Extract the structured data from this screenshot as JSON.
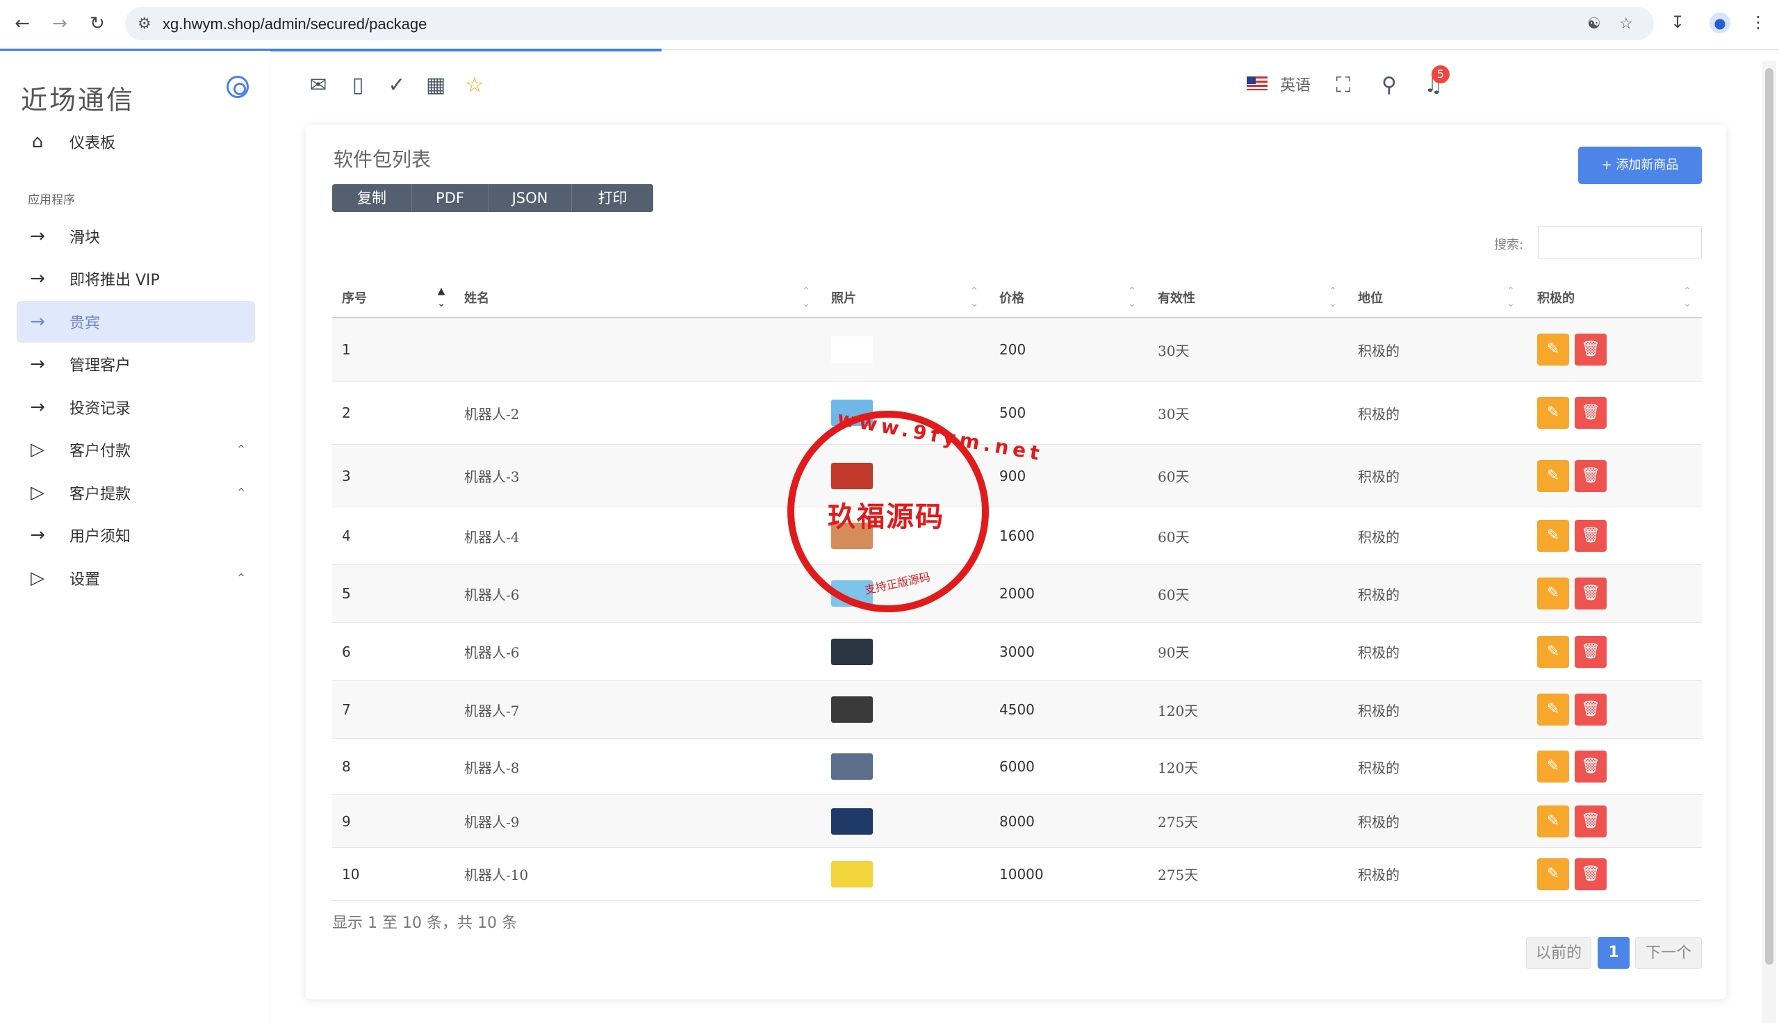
{
  "browser": {
    "url": "xg.hwym.shop/admin/secured/package"
  },
  "sidebar": {
    "brand": "近场通信",
    "section": "应用程序",
    "dashboard": "仪表板",
    "items": [
      {
        "label": "滑块"
      },
      {
        "label": "即将推出 VIP"
      },
      {
        "label": "贵宾"
      },
      {
        "label": "管理客户"
      },
      {
        "label": "投资记录"
      },
      {
        "label": "客户付款"
      },
      {
        "label": "客户提款"
      },
      {
        "label": "用户须知"
      },
      {
        "label": "设置"
      }
    ]
  },
  "topbar": {
    "language": "英语",
    "notification_count": "5"
  },
  "card": {
    "title": "软件包列表",
    "add_button": "+ 添加新商品",
    "export": [
      "复制",
      "PDF",
      "JSON",
      "打印"
    ],
    "search_label": "搜索:",
    "columns": [
      "序号",
      "姓名",
      "照片",
      "价格",
      "有效性",
      "地位",
      "积极的"
    ],
    "rows": [
      {
        "no": "1",
        "name": "",
        "price": "200",
        "validity": "30天",
        "status": "积极的",
        "photo_color": "#ffffff"
      },
      {
        "no": "2",
        "name": "机器人-2",
        "price": "500",
        "validity": "30天",
        "status": "积极的",
        "photo_color": "#6fb7e8"
      },
      {
        "no": "3",
        "name": "机器人-3",
        "price": "900",
        "validity": "60天",
        "status": "积极的",
        "photo_color": "#c0392b"
      },
      {
        "no": "4",
        "name": "机器人-4",
        "price": "1600",
        "validity": "60天",
        "status": "积极的",
        "photo_color": "#d68b5a"
      },
      {
        "no": "5",
        "name": "机器人-6",
        "price": "2000",
        "validity": "60天",
        "status": "积极的",
        "photo_color": "#7ec3ea"
      },
      {
        "no": "6",
        "name": "机器人-6",
        "price": "3000",
        "validity": "90天",
        "status": "积极的",
        "photo_color": "#2b3642"
      },
      {
        "no": "7",
        "name": "机器人-7",
        "price": "4500",
        "validity": "120天",
        "status": "积极的",
        "photo_color": "#3a3a3a"
      },
      {
        "no": "8",
        "name": "机器人-8",
        "price": "6000",
        "validity": "120天",
        "status": "积极的",
        "photo_color": "#5b6e8a"
      },
      {
        "no": "9",
        "name": "机器人-9",
        "price": "8000",
        "validity": "275天",
        "status": "积极的",
        "photo_color": "#1e3a66"
      },
      {
        "no": "10",
        "name": "机器人-10",
        "price": "10000",
        "validity": "275天",
        "status": "积极的",
        "photo_color": "#f2d43b"
      }
    ],
    "info": "显示 1 至 10 条，共 10 条",
    "pager": {
      "prev": "以前的",
      "current": "1",
      "next": "下一个"
    }
  },
  "watermark": {
    "main": "玖福源码",
    "ring": "www.9fym.net",
    "sub": "支持正版源码"
  },
  "colors": {
    "accent": "#4d84e8",
    "edit": "#f6a72c",
    "delete": "#ef5350",
    "active_bg": "#e0e8fb",
    "seal": "#e11b1b"
  }
}
